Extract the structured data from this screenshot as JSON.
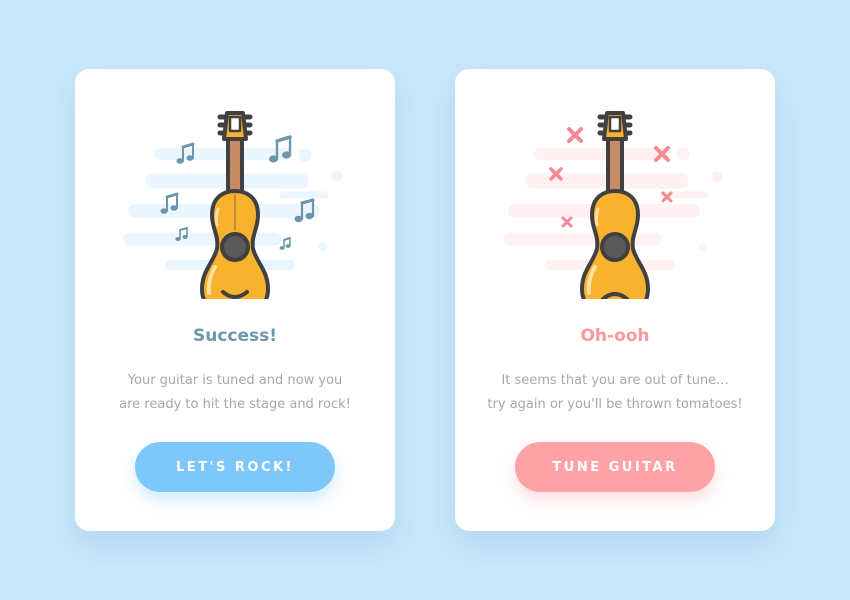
{
  "colors": {
    "background": "#c8e7fc",
    "card": "#ffffff",
    "success_accent": "#7ec7fb",
    "success_title": "#6b96ab",
    "failure_accent": "#fda3a8",
    "failure_title": "#f7999e",
    "body_text": "#a2a9b0",
    "guitar_body": "#f9b22e",
    "outline": "#404040"
  },
  "cards": [
    {
      "state": "success",
      "illustration": "happy-guitar-icon",
      "decorations": "music-note-icon",
      "title": "Success!",
      "message_lines": [
        "Your guitar is tuned and now you",
        "are ready to hit the stage and rock!"
      ],
      "button_label": "LET'S ROCK!"
    },
    {
      "state": "failure",
      "illustration": "sad-guitar-icon",
      "decorations": "cross-mark-icon",
      "title": "Oh-ooh",
      "message_lines": [
        "It seems that you are out of tune...",
        "try again or you'll be thrown tomatoes!"
      ],
      "button_label": "TUNE GUITAR"
    }
  ]
}
